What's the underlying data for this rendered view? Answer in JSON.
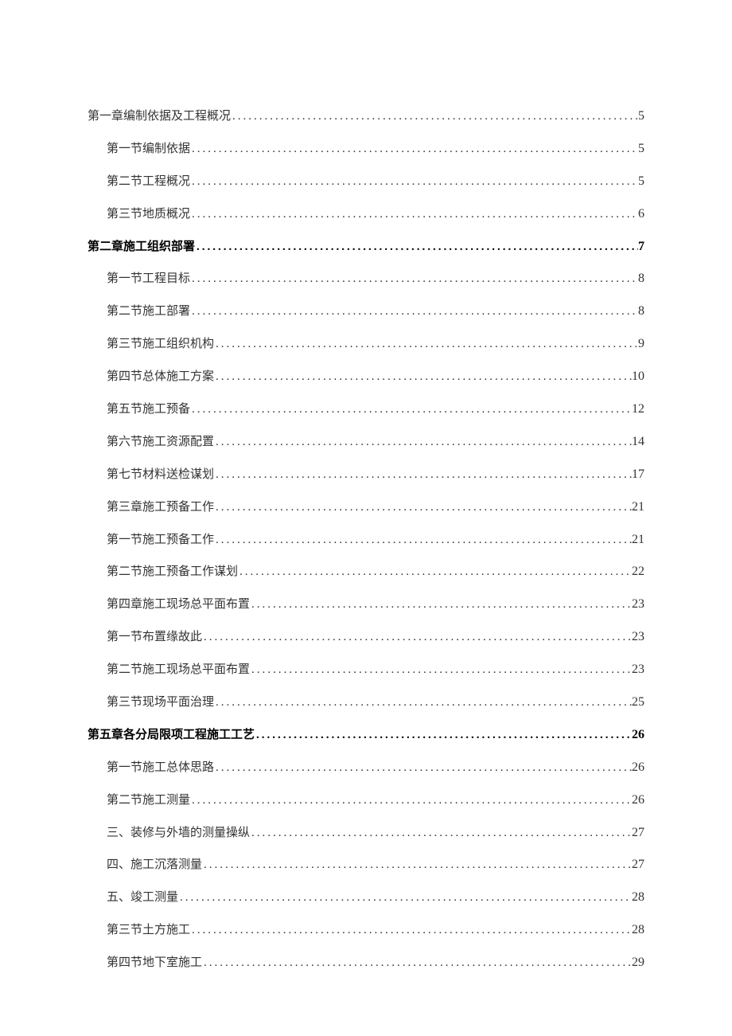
{
  "toc": [
    {
      "title": "第一章编制依据及工程概况",
      "page": "5",
      "level": 1,
      "bold": false
    },
    {
      "title": "第一节编制依据",
      "page": "5",
      "level": 2,
      "bold": false
    },
    {
      "title": "第二节工程概况",
      "page": "5",
      "level": 2,
      "bold": false
    },
    {
      "title": "第三节地质概况",
      "page": "6",
      "level": 2,
      "bold": false
    },
    {
      "title": "第二章施工组织部署",
      "page": "7",
      "level": 1,
      "bold": true
    },
    {
      "title": "第一节工程目标",
      "page": "8",
      "level": 2,
      "bold": false
    },
    {
      "title": "第二节施工部署",
      "page": "8",
      "level": 2,
      "bold": false
    },
    {
      "title": "第三节施工组织机构",
      "page": "9",
      "level": 2,
      "bold": false
    },
    {
      "title": "第四节总体施工方案",
      "page": "10",
      "level": 2,
      "bold": false
    },
    {
      "title": "第五节施工预备",
      "page": "12",
      "level": 2,
      "bold": false
    },
    {
      "title": "第六节施工资源配置",
      "page": "14",
      "level": 2,
      "bold": false
    },
    {
      "title": "第七节材料送检谋划",
      "page": "17",
      "level": 2,
      "bold": false
    },
    {
      "title": "第三章施工预备工作",
      "page": "21",
      "level": 2,
      "bold": false
    },
    {
      "title": "第一节施工预备工作",
      "page": "21",
      "level": 2,
      "bold": false
    },
    {
      "title": "第二节施工预备工作谋划",
      "page": "22",
      "level": 2,
      "bold": false
    },
    {
      "title": "第四章施工现场总平面布置",
      "page": "23",
      "level": 2,
      "bold": false
    },
    {
      "title": "第一节布置缘故此",
      "page": "23",
      "level": 2,
      "bold": false
    },
    {
      "title": "第二节施工现场总平面布置",
      "page": "23",
      "level": 2,
      "bold": false
    },
    {
      "title": "第三节现场平面治理",
      "page": "25",
      "level": 2,
      "bold": false
    },
    {
      "title": "第五章各分局限项工程施工工艺",
      "page": "26",
      "level": 1,
      "bold": true
    },
    {
      "title": "第一节施工总体思路",
      "page": "26",
      "level": 2,
      "bold": false
    },
    {
      "title": "第二节施工测量",
      "page": "26",
      "level": 2,
      "bold": false
    },
    {
      "title": "三、装修与外墙的测量操纵",
      "page": "27",
      "level": 2,
      "bold": false
    },
    {
      "title": "四、施工沉落测量",
      "page": "27",
      "level": 2,
      "bold": false
    },
    {
      "title": "五、竣工测量",
      "page": "28",
      "level": 2,
      "bold": false
    },
    {
      "title": "第三节土方施工",
      "page": "28",
      "level": 2,
      "bold": false
    },
    {
      "title": "第四节地下室施工",
      "page": "29",
      "level": 2,
      "bold": false
    }
  ]
}
